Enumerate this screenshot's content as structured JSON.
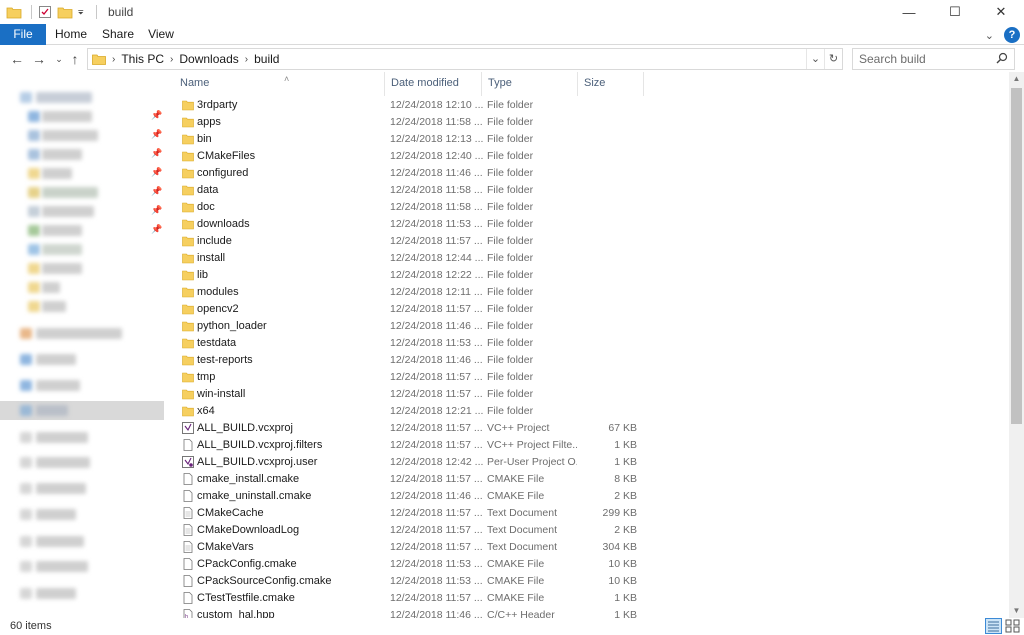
{
  "titlebar": {
    "title": "build",
    "controls": {
      "minimize": "—",
      "maximize": "☐",
      "close": "✕"
    }
  },
  "ribbon": {
    "tabs": [
      {
        "label": "File"
      },
      {
        "label": "Home"
      },
      {
        "label": "Share"
      },
      {
        "label": "View"
      }
    ],
    "help_label": "?"
  },
  "address": {
    "crumbs": [
      "This PC",
      "Downloads",
      "build"
    ]
  },
  "search": {
    "placeholder": "Search build"
  },
  "columns": {
    "name": "Name",
    "date": "Date modified",
    "type": "Type",
    "size": "Size"
  },
  "files": [
    {
      "name": "3rdparty",
      "date": "12/24/2018 12:10 ...",
      "type": "File folder",
      "size": "",
      "icon": "folder-icon"
    },
    {
      "name": "apps",
      "date": "12/24/2018 11:58 ...",
      "type": "File folder",
      "size": "",
      "icon": "folder-icon"
    },
    {
      "name": "bin",
      "date": "12/24/2018 12:13 ...",
      "type": "File folder",
      "size": "",
      "icon": "folder-icon"
    },
    {
      "name": "CMakeFiles",
      "date": "12/24/2018 12:40 ...",
      "type": "File folder",
      "size": "",
      "icon": "folder-icon"
    },
    {
      "name": "configured",
      "date": "12/24/2018 11:46 ...",
      "type": "File folder",
      "size": "",
      "icon": "folder-icon"
    },
    {
      "name": "data",
      "date": "12/24/2018 11:58 ...",
      "type": "File folder",
      "size": "",
      "icon": "folder-icon"
    },
    {
      "name": "doc",
      "date": "12/24/2018 11:58 ...",
      "type": "File folder",
      "size": "",
      "icon": "folder-icon"
    },
    {
      "name": "downloads",
      "date": "12/24/2018 11:53 ...",
      "type": "File folder",
      "size": "",
      "icon": "folder-icon"
    },
    {
      "name": "include",
      "date": "12/24/2018 11:57 ...",
      "type": "File folder",
      "size": "",
      "icon": "folder-icon"
    },
    {
      "name": "install",
      "date": "12/24/2018 12:44 ...",
      "type": "File folder",
      "size": "",
      "icon": "folder-icon"
    },
    {
      "name": "lib",
      "date": "12/24/2018 12:22 ...",
      "type": "File folder",
      "size": "",
      "icon": "folder-icon"
    },
    {
      "name": "modules",
      "date": "12/24/2018 12:11 ...",
      "type": "File folder",
      "size": "",
      "icon": "folder-icon"
    },
    {
      "name": "opencv2",
      "date": "12/24/2018 11:57 ...",
      "type": "File folder",
      "size": "",
      "icon": "folder-icon"
    },
    {
      "name": "python_loader",
      "date": "12/24/2018 11:46 ...",
      "type": "File folder",
      "size": "",
      "icon": "folder-icon"
    },
    {
      "name": "testdata",
      "date": "12/24/2018 11:53 ...",
      "type": "File folder",
      "size": "",
      "icon": "folder-icon"
    },
    {
      "name": "test-reports",
      "date": "12/24/2018 11:46 ...",
      "type": "File folder",
      "size": "",
      "icon": "folder-icon"
    },
    {
      "name": "tmp",
      "date": "12/24/2018 11:57 ...",
      "type": "File folder",
      "size": "",
      "icon": "folder-icon"
    },
    {
      "name": "win-install",
      "date": "12/24/2018 11:57 ...",
      "type": "File folder",
      "size": "",
      "icon": "folder-icon"
    },
    {
      "name": "x64",
      "date": "12/24/2018 12:21 ...",
      "type": "File folder",
      "size": "",
      "icon": "folder-icon"
    },
    {
      "name": "ALL_BUILD.vcxproj",
      "date": "12/24/2018 11:57 ...",
      "type": "VC++ Project",
      "size": "67 KB",
      "icon": "vcxproj-icon"
    },
    {
      "name": "ALL_BUILD.vcxproj.filters",
      "date": "12/24/2018 11:57 ...",
      "type": "VC++ Project Filte...",
      "size": "1 KB",
      "icon": "file-icon"
    },
    {
      "name": "ALL_BUILD.vcxproj.user",
      "date": "12/24/2018 12:42 ...",
      "type": "Per-User Project O...",
      "size": "1 KB",
      "icon": "vcxproj-user-icon"
    },
    {
      "name": "cmake_install.cmake",
      "date": "12/24/2018 11:57 ...",
      "type": "CMAKE File",
      "size": "8 KB",
      "icon": "file-icon"
    },
    {
      "name": "cmake_uninstall.cmake",
      "date": "12/24/2018 11:46 ...",
      "type": "CMAKE File",
      "size": "2 KB",
      "icon": "file-icon"
    },
    {
      "name": "CMakeCache",
      "date": "12/24/2018 11:57 ...",
      "type": "Text Document",
      "size": "299 KB",
      "icon": "text-file-icon"
    },
    {
      "name": "CMakeDownloadLog",
      "date": "12/24/2018 11:57 ...",
      "type": "Text Document",
      "size": "2 KB",
      "icon": "text-file-icon"
    },
    {
      "name": "CMakeVars",
      "date": "12/24/2018 11:57 ...",
      "type": "Text Document",
      "size": "304 KB",
      "icon": "text-file-icon"
    },
    {
      "name": "CPackConfig.cmake",
      "date": "12/24/2018 11:53 ...",
      "type": "CMAKE File",
      "size": "10 KB",
      "icon": "file-icon"
    },
    {
      "name": "CPackSourceConfig.cmake",
      "date": "12/24/2018 11:53 ...",
      "type": "CMAKE File",
      "size": "10 KB",
      "icon": "file-icon"
    },
    {
      "name": "CTestTestfile.cmake",
      "date": "12/24/2018 11:57 ...",
      "type": "CMAKE File",
      "size": "1 KB",
      "icon": "file-icon"
    },
    {
      "name": "custom_hal.hpp",
      "date": "12/24/2018 11:46 ...",
      "type": "C/C++ Header",
      "size": "1 KB",
      "icon": "header-file-icon"
    }
  ],
  "status": {
    "item_count": "60 items"
  },
  "colors": {
    "accent": "#1a6fc4",
    "folder": "#f6cf5f",
    "selected_nav": "#d9d9d9"
  }
}
